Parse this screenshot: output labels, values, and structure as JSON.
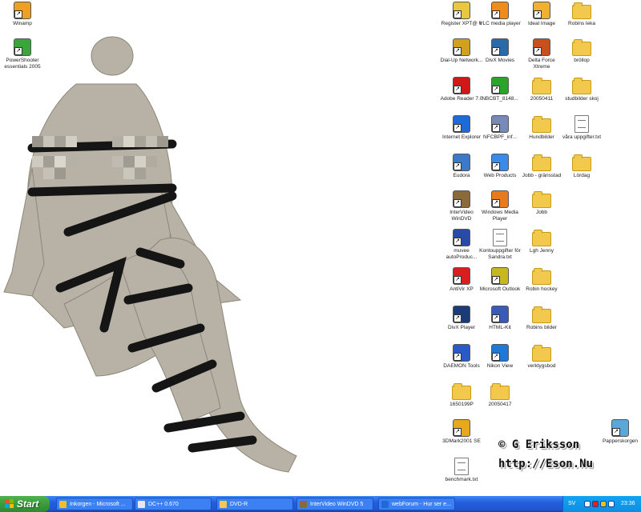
{
  "desktop": {
    "icons_left": [
      {
        "name": "winamp-icon",
        "label": "Winamp",
        "color": "#f0a020"
      },
      {
        "name": "powershooter-icon",
        "label": "PowerShooter essentials 2005",
        "color": "#3aa53a"
      }
    ],
    "icons_right": [
      {
        "name": "register-xp-icon",
        "label": "Register XPT@ 6",
        "color": "#e8c840"
      },
      {
        "name": "vlc-icon",
        "label": "VLC media player",
        "color": "#f08c1e"
      },
      {
        "name": "ideal-image-icon",
        "label": "Ideal Image",
        "color": "#f0b030"
      },
      {
        "name": "folder-icon",
        "label": "Robins leka",
        "color": "#f2c94c"
      },
      {
        "name": "dialup-icon",
        "label": "Dial-Up Network...",
        "color": "#d0a020"
      },
      {
        "name": "divx-movies-icon",
        "label": "DivX Movies",
        "color": "#2a6aa8"
      },
      {
        "name": "delta-force-icon",
        "label": "Delta Force Xtreme",
        "color": "#c8501e"
      },
      {
        "name": "folder-icon",
        "label": "bröllop",
        "color": "#f2c94c"
      },
      {
        "name": "adobe-reader-icon",
        "label": "Adobe Reader 7.0",
        "color": "#d01818"
      },
      {
        "name": "nero-icon",
        "label": "NBCBT_8148...",
        "color": "#2aa52a"
      },
      {
        "name": "folder-icon",
        "label": "20050411",
        "color": "#f2c94c"
      },
      {
        "name": "folder-icon",
        "label": "studbilder skoj",
        "color": "#f2c94c"
      },
      {
        "name": "ie-icon",
        "label": "Internet Explorer",
        "color": "#1e6ad8"
      },
      {
        "name": "nfc-icon",
        "label": "NFCBPF_inf...",
        "color": "#7a8ab8"
      },
      {
        "name": "folder-icon",
        "label": "Hundbilder",
        "color": "#f2c94c"
      },
      {
        "name": "document-icon",
        "label": "våra uppgifter.txt",
        "color": "#ffffff"
      },
      {
        "name": "eudora-icon",
        "label": "Eudora",
        "color": "#3a7ac8"
      },
      {
        "name": "web-products-icon",
        "label": "Web Products",
        "color": "#3a8ae8"
      },
      {
        "name": "folder-icon",
        "label": "Jobb - gränsstad",
        "color": "#f2c94c"
      },
      {
        "name": "folder-icon",
        "label": "Lördag",
        "color": "#f2c94c"
      },
      {
        "name": "intervideo-icon",
        "label": "InterVideo WinDVD",
        "color": "#8a6a3a"
      },
      {
        "name": "wmp-icon",
        "label": "Windows Media Player",
        "color": "#e87a1e"
      },
      {
        "name": "folder-icon",
        "label": "Jobb",
        "color": "#f2c94c"
      },
      {
        "name": "muvee-icon",
        "label": "muvee autoProduc...",
        "color": "#2a4aa8"
      },
      {
        "name": "document-icon",
        "label": "Kontouppgifter för Sandra.txt",
        "color": "#ffffff"
      },
      {
        "name": "folder-icon",
        "label": "Lgh Jenny",
        "color": "#f2c94c"
      },
      {
        "name": "antivir-icon",
        "label": "AntiVir XP",
        "color": "#d81e1e"
      },
      {
        "name": "outlook-icon",
        "label": "Microsoft Outlook",
        "color": "#c8b820"
      },
      {
        "name": "folder-icon",
        "label": "Robin hockey",
        "color": "#f2c94c"
      },
      {
        "name": "divx-player-icon",
        "label": "DivX Player",
        "color": "#1a3a78"
      },
      {
        "name": "html-kit-icon",
        "label": "HTML-Kit",
        "color": "#3a5ab8"
      },
      {
        "name": "folder-icon",
        "label": "Robins bilder",
        "color": "#f2c94c"
      },
      {
        "name": "daemon-tools-icon",
        "label": "DAEMON Tools",
        "color": "#2a5ac8"
      },
      {
        "name": "nikon-view-icon",
        "label": "Nikon View",
        "color": "#1e78d8"
      },
      {
        "name": "folder-icon",
        "label": "verktygsbod",
        "color": "#f2c94c"
      },
      {
        "name": "folder-icon",
        "label": "1650199P",
        "color": "#f2c94c"
      },
      {
        "name": "folder-icon",
        "label": "20050417",
        "color": "#f2c94c"
      },
      {
        "name": "3dmark-icon",
        "label": "3DMark2001 SE",
        "color": "#e8a81e"
      },
      {
        "name": "recycle-bin-icon",
        "label": "Papperskorgen",
        "color": "#5aa8d8"
      },
      {
        "name": "document-icon",
        "label": "benchmark.txt",
        "color": "#ffffff"
      }
    ]
  },
  "watermark": {
    "line1": "© G Eriksson",
    "line2": "http://Eson.Nu"
  },
  "taskbar": {
    "start_label": "Start",
    "tasks": [
      {
        "label": "Inkorgen - Microsoft ...",
        "color": "#f0c020"
      },
      {
        "label": "DC++ 0.670",
        "color": "#e8e8e8"
      },
      {
        "label": "DVD-R",
        "color": "#f2c94c"
      },
      {
        "label": "InterVideo WinDVD 5",
        "color": "#8a6a3a"
      },
      {
        "label": "webForum - Hur ser e...",
        "color": "#1e6ad8"
      }
    ],
    "tray": {
      "language": "SV",
      "clock": "23:36",
      "icon_colors": [
        "#f0f0f0",
        "#e82020",
        "#e8c020",
        "#f0f0f0"
      ]
    }
  }
}
